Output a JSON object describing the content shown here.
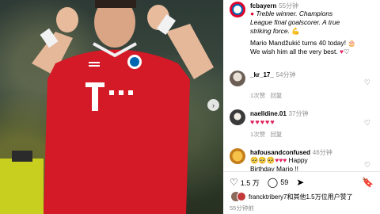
{
  "post": {
    "author": "fcbayern",
    "time": "55分钟",
    "caption_line1": "Treble winner. Champions",
    "caption_line2": "League final goalscorer. A true",
    "caption_line3": "striking force.",
    "caption_line4": "Mario Mandžukić turns 40 today!",
    "caption_line5": "We wish him all the very best."
  },
  "comments": [
    {
      "user": "_kr_17_",
      "time": "54分钟",
      "likes": "1次赞",
      "reply": "回复"
    },
    {
      "user": "naelldine.01",
      "time": "37分钟",
      "text": "♥♥♥♥♥",
      "likes": "1次赞",
      "reply": "回复"
    },
    {
      "user": "hafousandconfused",
      "time": "46分钟",
      "text_line1": "🥺🥺🥺♥♥♥",
      "text_line2": "Happy",
      "text_line3": "Birthday Mario !!"
    }
  ],
  "actions": {
    "likes": "1.5 万",
    "comments": "59"
  },
  "liked_by": "francktribery7和其他1.5万位用户赞了",
  "post_time": "55分钟前",
  "icons": {
    "next": "chevron-right-icon",
    "like": "heart-icon",
    "comment": "comment-icon",
    "share": "send-icon",
    "save": "bookmark-icon"
  },
  "colors": {
    "accent_red": "#dc052d",
    "heart_red": "#e0245e"
  }
}
